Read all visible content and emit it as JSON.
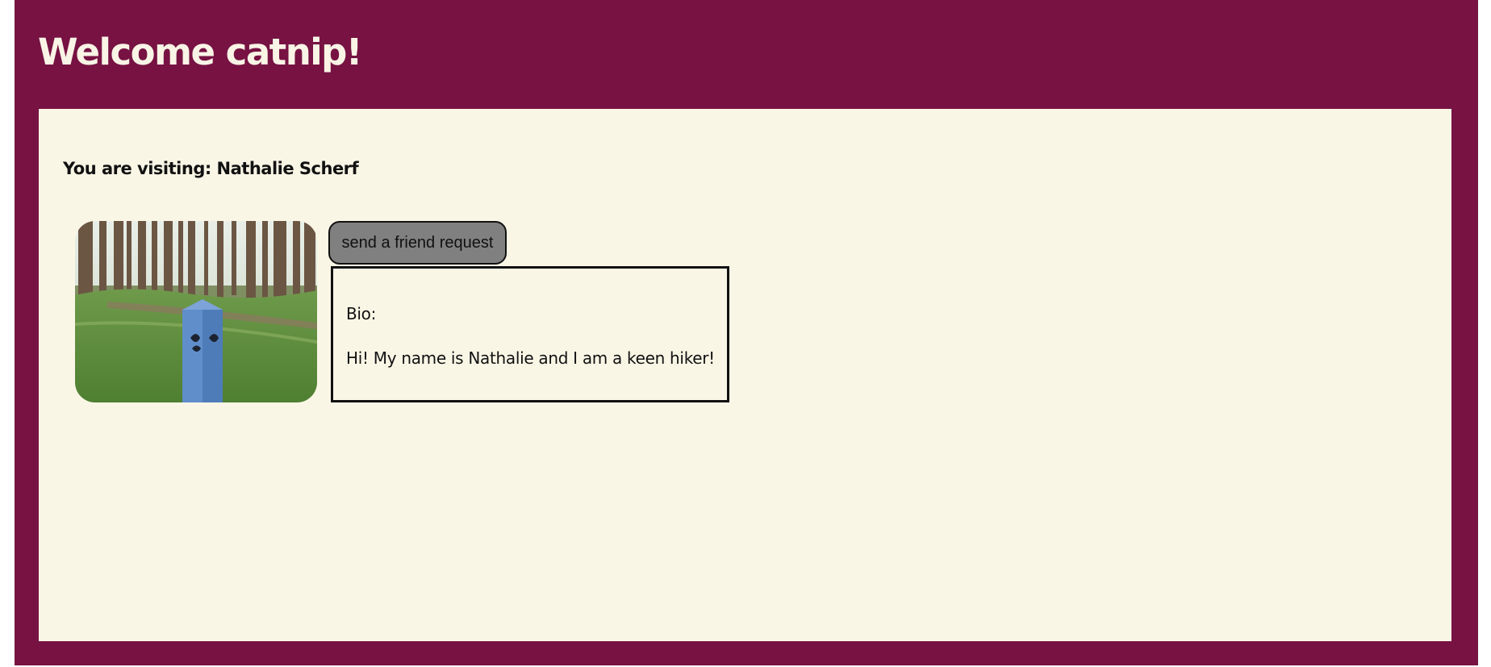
{
  "header": {
    "title": "Welcome catnip!"
  },
  "profile": {
    "visiting_text": "You are visiting: Nathalie Scherf",
    "photo_description": "forest-trail-marker-photo",
    "friend_request_label": "send a friend request",
    "bio_label": "Bio:",
    "bio_text": "Hi! My name is Nathalie and I am a keen hiker!"
  },
  "colors": {
    "frame": "#771243",
    "panel": "#faf6e6",
    "title_text": "#f9f4e6",
    "button": "#808080"
  }
}
